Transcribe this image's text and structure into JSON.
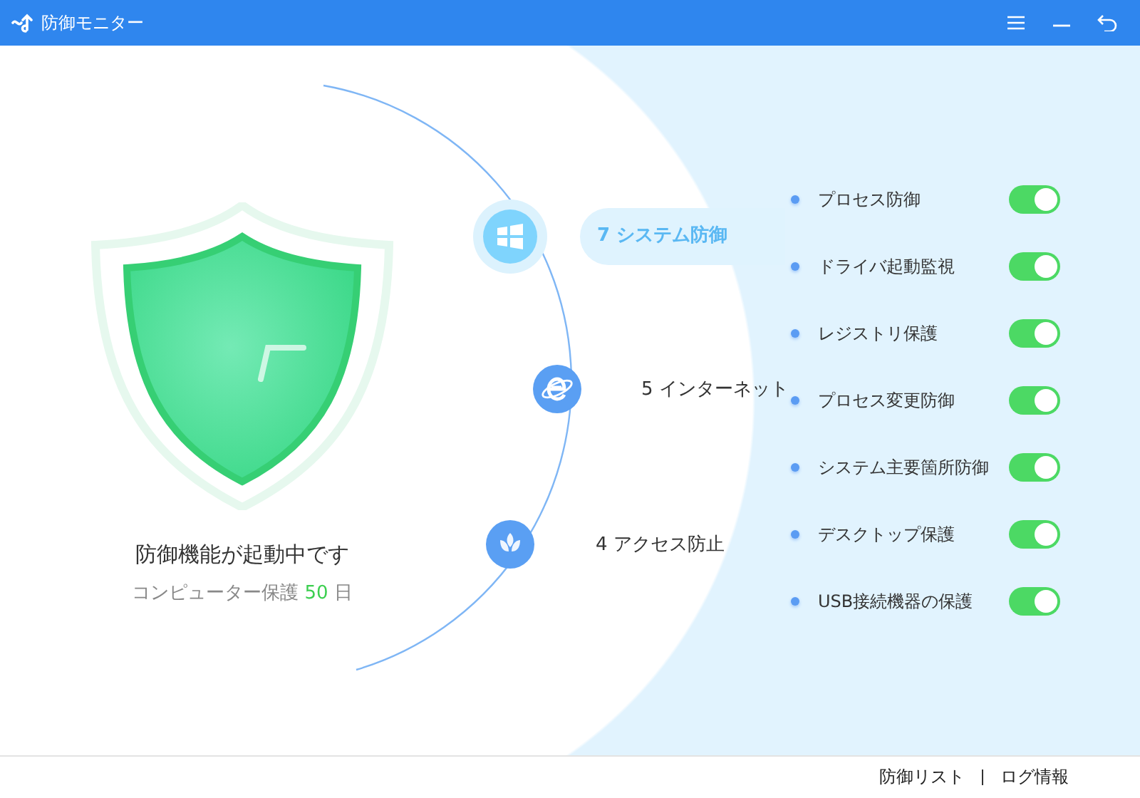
{
  "window": {
    "title": "防御モニター"
  },
  "status": {
    "headline": "防御機能が起動中です",
    "protected_prefix": "コンピューター保護",
    "protected_days": "50",
    "protected_suffix": "日"
  },
  "categories": [
    {
      "kind": "windows",
      "label": "7 システム防御",
      "selected": true
    },
    {
      "kind": "browser",
      "label": "5 インターネット",
      "selected": false
    },
    {
      "kind": "plant",
      "label": "4 アクセス防止",
      "selected": false
    }
  ],
  "features": [
    {
      "label": "プロセス防御",
      "on": true
    },
    {
      "label": "ドライバ起動監視",
      "on": true
    },
    {
      "label": "レジストリ保護",
      "on": true
    },
    {
      "label": "プロセス変更防御",
      "on": true
    },
    {
      "label": "システム主要箇所防御",
      "on": true
    },
    {
      "label": "デスクトップ保護",
      "on": true
    },
    {
      "label": "USB接続機器の保護",
      "on": true
    }
  ],
  "footer_links": [
    "防御リスト",
    "ログ情報"
  ]
}
